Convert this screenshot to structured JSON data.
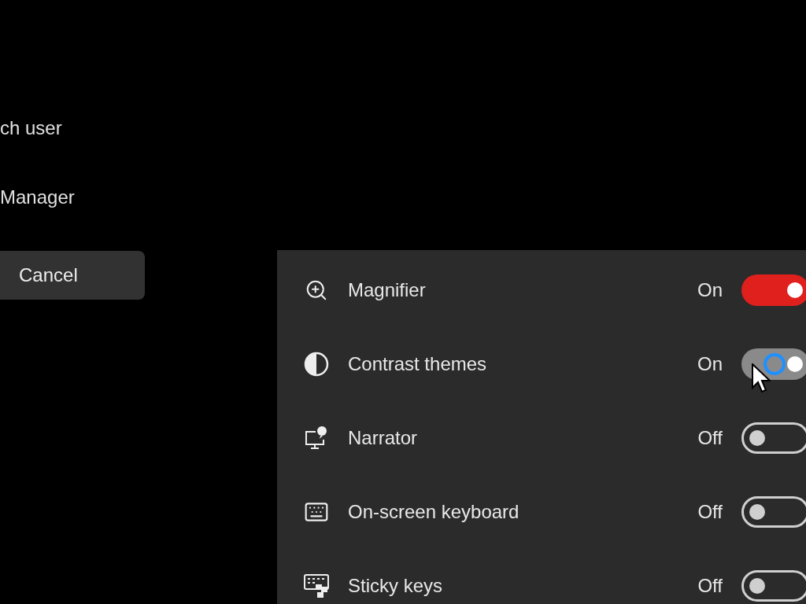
{
  "options": [
    {
      "label": "ch user"
    },
    {
      "label": "Manager"
    }
  ],
  "cancel_button": "Cancel",
  "accessibility": [
    {
      "label": "Magnifier",
      "status": "On",
      "on": true,
      "pending": false
    },
    {
      "label": "Contrast themes",
      "status": "On",
      "on": true,
      "pending": true
    },
    {
      "label": "Narrator",
      "status": "Off",
      "on": false,
      "pending": false
    },
    {
      "label": "On-screen keyboard",
      "status": "Off",
      "on": false,
      "pending": false
    },
    {
      "label": "Sticky keys",
      "status": "Off",
      "on": false,
      "pending": false
    }
  ]
}
